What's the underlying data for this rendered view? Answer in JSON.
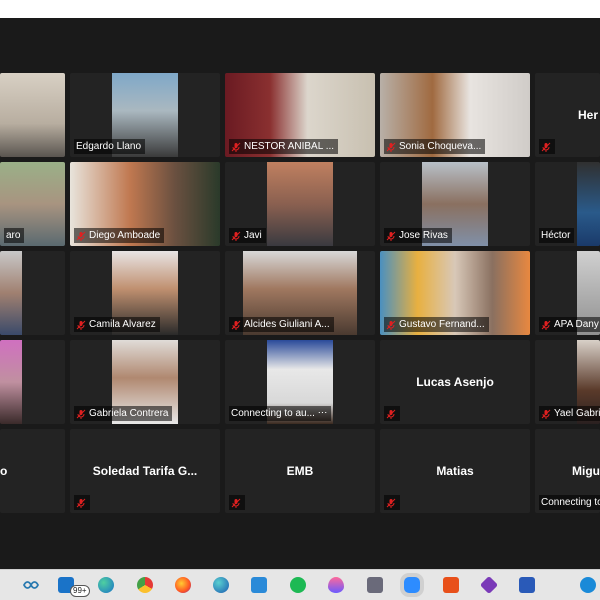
{
  "participants": {
    "r1": [
      "",
      "Edgardo Llano",
      "NESTOR ANIBAL ...",
      "Sonia  Choqueva...",
      "Her"
    ],
    "r2": [
      "aro",
      "Diego Amboade",
      "Javi",
      "Jose Rivas",
      "Héctor"
    ],
    "r3": [
      "",
      "Camila Alvarez",
      "Alcides Giuliani A...",
      "Gustavo Fernand...",
      "APA Dany J"
    ],
    "r4": [
      "",
      "Gabriela Contrera",
      "Connecting to au... ⋅⋅⋅",
      "Lucas Asenjo",
      "Yael Gabrie"
    ],
    "r5": [
      "o",
      "Soledad Tarifa G...",
      "EMB",
      "Matias",
      "Migu"
    ]
  },
  "connecting_label": "Connecting to",
  "taskbar": {
    "badge": "99+",
    "icons": [
      "widgets-icon",
      "mail-icon",
      "edge-icon",
      "chrome-icon",
      "firefox-icon",
      "edge-dev-icon",
      "outlook-icon",
      "spotify-icon",
      "drop-icon",
      "calculator-icon",
      "zoom-icon",
      "office-icon",
      "visual-studio-icon",
      "word-icon",
      "help-icon"
    ]
  },
  "colors": {
    "bg": "#1a1a1a",
    "tile": "#232323",
    "muted": "#e02020"
  }
}
